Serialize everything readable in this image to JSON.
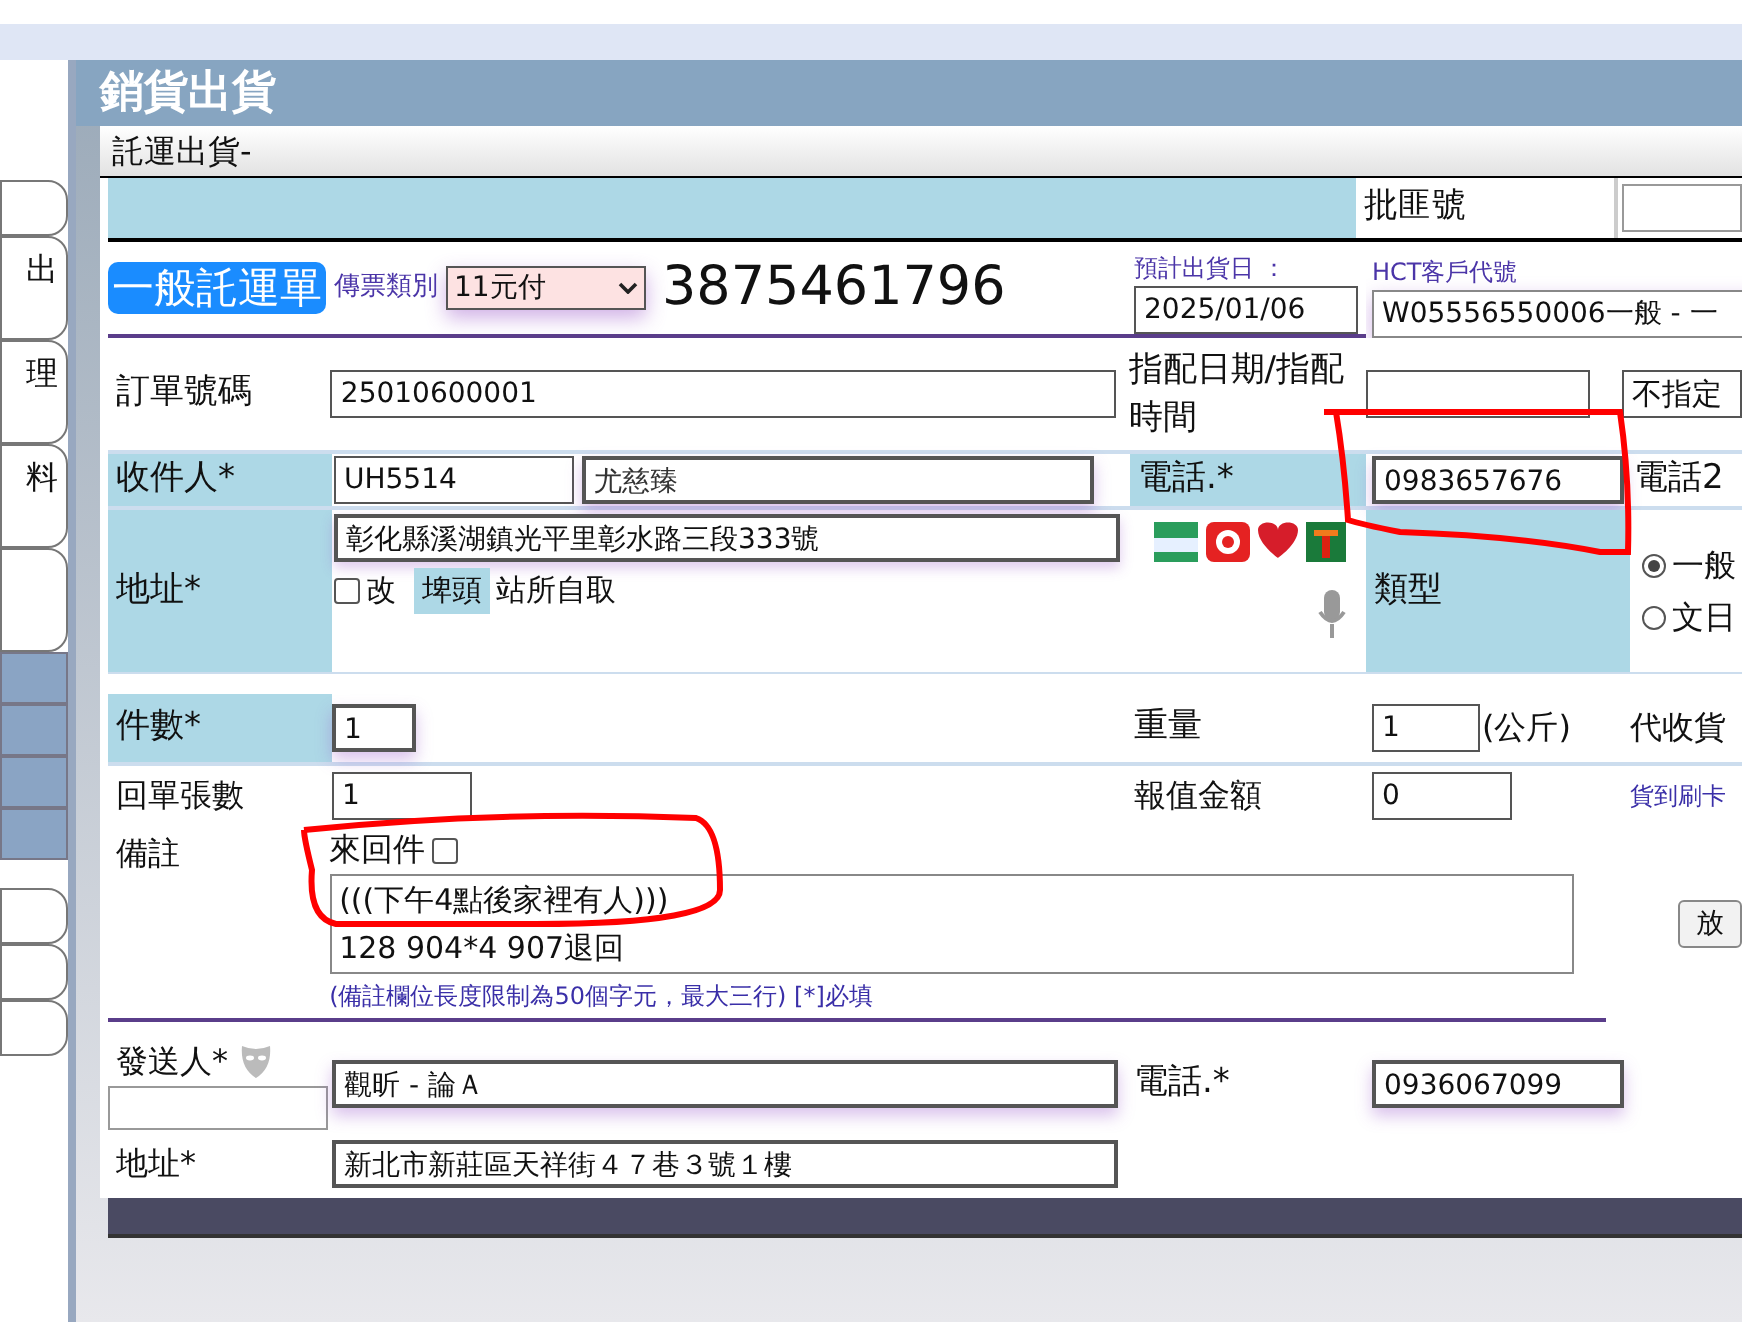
{
  "sidebar": {
    "items": [
      {
        "label": "出"
      },
      {
        "label": "理"
      },
      {
        "label": "料"
      }
    ]
  },
  "header": {
    "title": "銷貨出貨"
  },
  "dialog": {
    "title": "託運出貨-"
  },
  "form": {
    "batch_label": "批匪號",
    "waybill_badge": "一般託運單",
    "ticket_type": {
      "label": "傳票類別",
      "value": "11元付"
    },
    "waybill_number": "3875461796",
    "ship_date": {
      "label": "預計出貨日 ：",
      "value": "2025/01/06"
    },
    "customer_code": {
      "label": "HCT客戶代號",
      "value": "W05556550006一般 - 一"
    },
    "order_no": {
      "label": "訂單號碼",
      "value": "25010600001"
    },
    "assign": {
      "label": "指配日期/指配時間",
      "time": "不指定"
    },
    "receiver": {
      "label": "收件人*",
      "code": "UH5514",
      "name": "尤慈臻"
    },
    "receiver_phone": {
      "label": "電話.*",
      "value": "0983657676"
    },
    "phone2_label": "電話2",
    "address": {
      "label": "地址*",
      "value": "彰化縣溪湖鎮光平里彰水路三段333號",
      "change_label": "改",
      "station": "埤頭",
      "pickup_label": "站所自取",
      "change_checked": false
    },
    "type": {
      "label": "類型",
      "options": [
        {
          "label": "一般",
          "selected": true
        },
        {
          "label": "文日",
          "selected": false
        }
      ]
    },
    "pieces": {
      "label": "件數*",
      "value": "1"
    },
    "weight": {
      "label": "重量",
      "value": "1",
      "unit": "(公斤)"
    },
    "cod_label": "代收貨",
    "receipts": {
      "label": "回單張數",
      "value": "1"
    },
    "declared": {
      "label": "報值金額",
      "value": "0"
    },
    "card_link": "貨到刷卡",
    "remark": {
      "label": "備註",
      "round_trip_label": "來回件",
      "round_trip_checked": false,
      "lines": [
        "(((下午4點後家裡有人)))",
        "128 904*4 907退回"
      ],
      "hint": "(備註欄位長度限制為50個字元，最大三行) [*]必填"
    },
    "side_button": "放",
    "sender": {
      "label": "發送人*",
      "name": "觀昕 - 論Ａ"
    },
    "sender_phone": {
      "label": "電話.*",
      "value": "0936067099"
    },
    "sender_address": {
      "label": "地址*",
      "value": "新北市新莊區天祥街４７巷３號１樓"
    }
  }
}
